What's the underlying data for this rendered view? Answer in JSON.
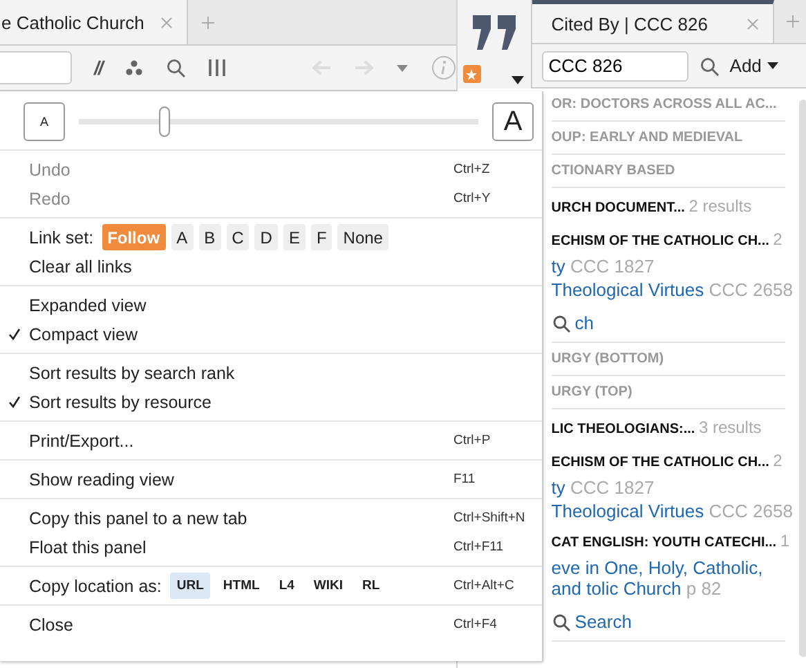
{
  "left_panel": {
    "tab": {
      "title": "e Catholic Church",
      "selected": true
    },
    "toolbar": {
      "link_label": "//"
    }
  },
  "right_panel": {
    "tab": {
      "title": "Cited By | CCC 826",
      "selected": true
    },
    "search": {
      "value": "CCC 826"
    },
    "add_button": "Add",
    "results": [
      {
        "kind": "group",
        "label": "OR: DOCTORS ACROSS ALL AC..."
      },
      {
        "kind": "group",
        "label": "OUP: EARLY AND MEDIEVAL"
      },
      {
        "kind": "group",
        "label": "CTIONARY BASED"
      },
      {
        "kind": "resource",
        "label": "URCH DOCUMENT...",
        "count": "2 results"
      },
      {
        "kind": "subresource",
        "label": "ECHISM OF THE CATHOLIC CH...",
        "count": "2"
      },
      {
        "kind": "hit",
        "label": "ty",
        "ref": "CCC 1827"
      },
      {
        "kind": "hit",
        "label": "Theological Virtues",
        "ref": "CCC 2658"
      },
      {
        "kind": "more",
        "label": "ch"
      },
      {
        "kind": "group",
        "label": "URGY (BOTTOM)"
      },
      {
        "kind": "group",
        "label": "URGY (TOP)"
      },
      {
        "kind": "resource",
        "label": "LIC THEOLOGIANS:...",
        "count": "3 results"
      },
      {
        "kind": "subresource",
        "label": "ECHISM OF THE CATHOLIC CH...",
        "count": "2"
      },
      {
        "kind": "hit",
        "label": "ty",
        "ref": "CCC 1827"
      },
      {
        "kind": "hit",
        "label": "Theological Virtues",
        "ref": "CCC 2658"
      },
      {
        "kind": "subresource",
        "label": "CAT ENGLISH: YOUTH CATECHI...",
        "count": "1"
      },
      {
        "kind": "hit",
        "label": "eve in One, Holy, Catholic, and tolic Church",
        "ref": "p 82"
      },
      {
        "kind": "more",
        "label": "Search"
      }
    ]
  },
  "menu": {
    "font_size": {
      "small": "A",
      "large": "A",
      "level": 0.21
    },
    "sections": [
      [
        {
          "kind": "command",
          "label": "Undo",
          "shortcut": "Ctrl+Z",
          "disabled": true
        },
        {
          "kind": "command",
          "label": "Redo",
          "shortcut": "Ctrl+Y",
          "disabled": true
        }
      ],
      [
        {
          "kind": "linkset",
          "label": "Link set:",
          "options": [
            {
              "label": "Follow",
              "selected": true
            },
            {
              "label": "A",
              "selected": false
            },
            {
              "label": "B",
              "selected": false
            },
            {
              "label": "C",
              "selected": false
            },
            {
              "label": "D",
              "selected": false
            },
            {
              "label": "E",
              "selected": false
            },
            {
              "label": "F",
              "selected": false
            },
            {
              "label": "None",
              "selected": false
            }
          ]
        },
        {
          "kind": "command",
          "label": "Clear all links",
          "disabled": false
        }
      ],
      [
        {
          "kind": "check",
          "label": "Expanded view",
          "checked": false
        },
        {
          "kind": "check",
          "label": "Compact view",
          "checked": true
        }
      ],
      [
        {
          "kind": "check",
          "label": "Sort results by search rank",
          "checked": false
        },
        {
          "kind": "check",
          "label": "Sort results by resource",
          "checked": true
        }
      ],
      [
        {
          "kind": "command",
          "label": "Print/Export...",
          "shortcut": "Ctrl+P",
          "disabled": false
        }
      ],
      [
        {
          "kind": "command",
          "label": "Show reading view",
          "shortcut": "F11",
          "disabled": false
        }
      ],
      [
        {
          "kind": "command",
          "label": "Copy this panel to a new tab",
          "shortcut": "Ctrl+Shift+N",
          "disabled": false
        },
        {
          "kind": "command",
          "label": "Float this panel",
          "shortcut": "Ctrl+F11",
          "disabled": false
        }
      ],
      [
        {
          "kind": "copyas",
          "label": "Copy location as:",
          "shortcut": "Ctrl+Alt+C",
          "options": [
            {
              "label": "URL",
              "selected": true
            },
            {
              "label": "HTML",
              "selected": false
            },
            {
              "label": "L4",
              "selected": false
            },
            {
              "label": "WIKI",
              "selected": false
            },
            {
              "label": "RL",
              "selected": false
            }
          ]
        }
      ],
      [
        {
          "kind": "command",
          "label": "Close",
          "shortcut": "Ctrl+F4",
          "disabled": false
        }
      ]
    ]
  }
}
